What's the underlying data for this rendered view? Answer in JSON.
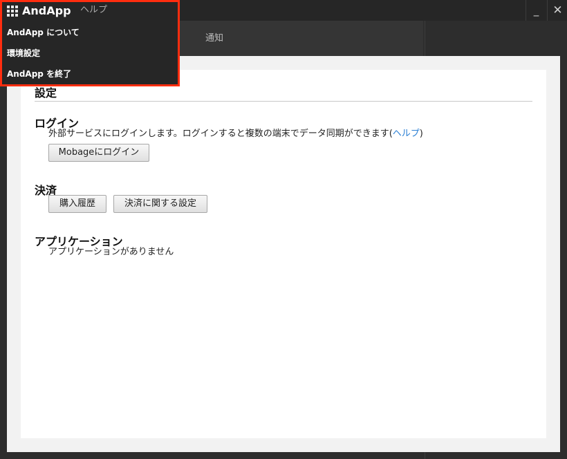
{
  "app": {
    "name": "AndApp"
  },
  "menubar": {
    "help_label": "ヘルプ"
  },
  "window_controls": {
    "minimize": "_",
    "close": "✕"
  },
  "tabs": {
    "notice_label": "通知"
  },
  "app_menu": {
    "items": [
      {
        "label": "AndApp について"
      },
      {
        "label": "環境設定"
      },
      {
        "label": "AndApp を終了"
      }
    ]
  },
  "settings": {
    "title": "設定",
    "login": {
      "heading": "ログイン",
      "description": "外部サービスにログインします。ログインすると複数の端末でデータ同期ができます(",
      "help_link": "ヘルプ",
      "description_end": ")",
      "button_label": "Mobageにログイン"
    },
    "payment": {
      "heading": "決済",
      "history_button": "購入履歴",
      "settings_button": "決済に関する設定"
    },
    "applications": {
      "heading": "アプリケーション",
      "empty_text": "アプリケーションがありません"
    }
  },
  "colors": {
    "highlight_border": "#ff2d0f",
    "link": "#2a7fd4",
    "titlebar_bg": "#262626"
  }
}
